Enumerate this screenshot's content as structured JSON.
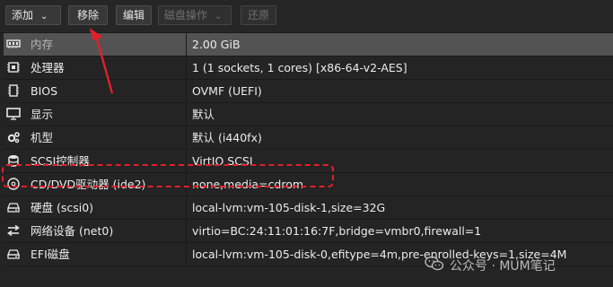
{
  "toolbar": {
    "add_label": "添加",
    "remove_label": "移除",
    "edit_label": "编辑",
    "disk_action_label": "磁盘操作",
    "revert_label": "还原"
  },
  "rows": [
    {
      "icon": "memory-icon",
      "key": "内存",
      "value": "2.00 GiB"
    },
    {
      "icon": "cpu-icon",
      "key": "处理器",
      "value": "1 (1 sockets, 1 cores) [x86-64-v2-AES]"
    },
    {
      "icon": "bios-chip-icon",
      "key": "BIOS",
      "value": "OVMF (UEFI)"
    },
    {
      "icon": "monitor-icon",
      "key": "显示",
      "value": "默认"
    },
    {
      "icon": "cogs-icon",
      "key": "机型",
      "value": "默认 (i440fx)"
    },
    {
      "icon": "database-icon",
      "key": "SCSI控制器",
      "value": "VirtIO SCSI"
    },
    {
      "icon": "cdrom-icon",
      "key": "CD/DVD驱动器 (ide2)",
      "value": "none,media=cdrom"
    },
    {
      "icon": "hdd-icon",
      "key": "硬盘 (scsi0)",
      "value": "local-lvm:vm-105-disk-1,size=32G"
    },
    {
      "icon": "network-exchange-icon",
      "key": "网络设备 (net0)",
      "value": "virtio=BC:24:11:01:16:7F,bridge=vmbr0,firewall=1"
    },
    {
      "icon": "hdd-icon",
      "key": "EFI磁盘",
      "value": "local-lvm:vm-105-disk-0,efitype=4m,pre-enrolled-keys=1,size=4M"
    }
  ],
  "watermark": {
    "text": "公众号 · MUM笔记"
  },
  "colors": {
    "annotation_red": "#e0202a",
    "selected_row": "#535353",
    "background": "#242424"
  }
}
